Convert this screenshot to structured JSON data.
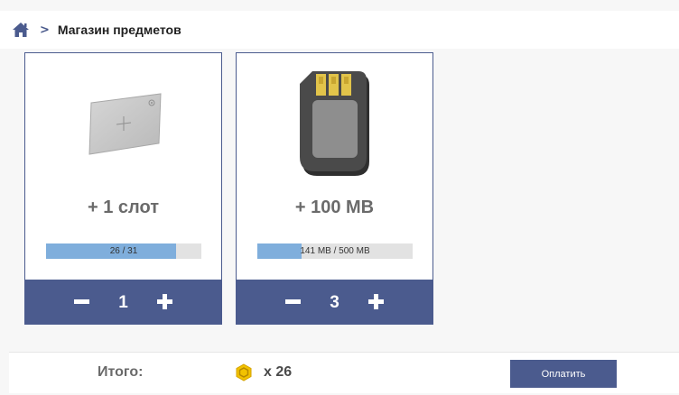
{
  "header": {
    "home_icon": "home-icon",
    "separator": ">",
    "title": "Магазин предметов"
  },
  "items": [
    {
      "icon": "card-slot-icon",
      "title": "+ 1 слот",
      "progress_text": "26 / 31",
      "progress_fraction": 0.839,
      "quantity": "1"
    },
    {
      "icon": "sim-card-icon",
      "title": "+ 100 MB",
      "progress_text": "141 MB / 500 MB",
      "progress_fraction": 0.282,
      "quantity": "3"
    }
  ],
  "footer": {
    "total_label": "Итого:",
    "currency_icon": "hex-coin-icon",
    "total_amount": "x 26",
    "pay_label": "Оплатить"
  },
  "colors": {
    "accent": "#4b5b8e",
    "progress_fill": "#7faedc",
    "coin": "#f2c200"
  }
}
